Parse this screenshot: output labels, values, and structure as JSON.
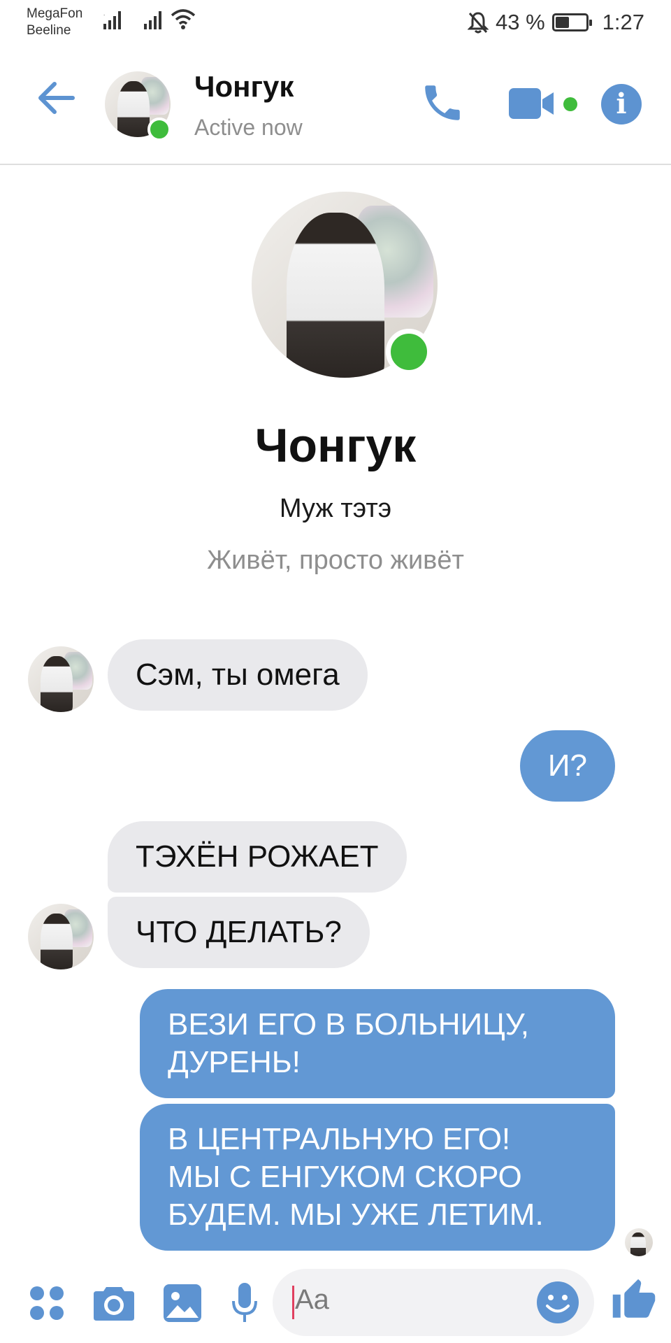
{
  "status_bar": {
    "carrier1": "MegaFon",
    "carrier2": "Beeline",
    "battery": "43 %",
    "battery_level": 0.43,
    "time": "1:27",
    "icons": [
      "signal-icon",
      "signal-icon",
      "wifi-icon",
      "mute-bell-icon",
      "battery-icon"
    ]
  },
  "header": {
    "contact_name": "Чонгук",
    "presence": "Active now",
    "icons": [
      "back-arrow-icon",
      "phone-icon",
      "video-camera-icon",
      "info-icon"
    ]
  },
  "profile": {
    "name": "Чонгук",
    "subtitle": "Муж тэтэ",
    "about": "Живёт, просто живёт"
  },
  "messages": [
    {
      "from": "them",
      "text": "Сэм, ты омега"
    },
    {
      "from": "me",
      "text": "И?"
    },
    {
      "from": "them",
      "text": "ТЭХЁН РОЖАЕТ"
    },
    {
      "from": "them",
      "text": "ЧТО ДЕЛАТЬ?"
    },
    {
      "from": "me",
      "line1": "ВЕЗИ ЕГО В БОЛЬНИЦУ,",
      "line2": "ДУРЕНЬ!"
    },
    {
      "from": "me",
      "line1": "В ЦЕНТРАЛЬНУЮ ЕГО!",
      "line2": "МЫ С ЕНГУКОМ СКОРО",
      "line3": "БУДЕМ. МЫ УЖЕ ЛЕТИМ."
    }
  ],
  "composer": {
    "placeholder": "Aa",
    "icons": [
      "apps-icon",
      "camera-icon",
      "gallery-icon",
      "microphone-icon",
      "emoji-icon",
      "thumbs-up-icon"
    ]
  },
  "colors": {
    "accent": "#5d93d1",
    "outgoing_bubble": "#6298d4",
    "incoming_bubble": "#e9e9ec",
    "online": "#3fbc3c"
  }
}
